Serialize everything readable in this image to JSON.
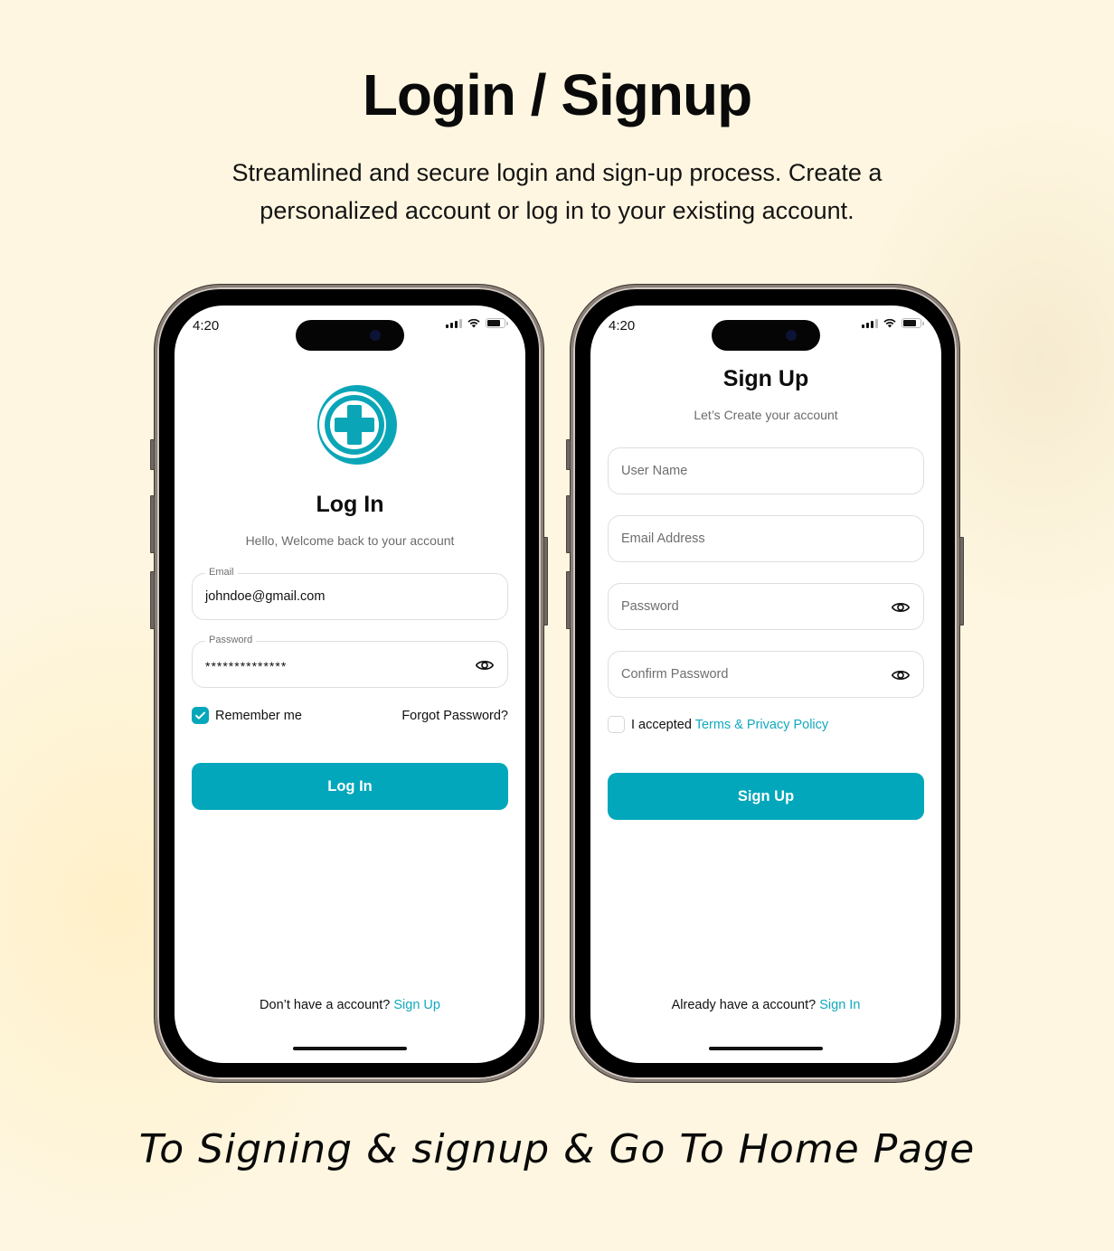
{
  "header": {
    "title": "Login / Signup",
    "subtitle": "Streamlined and secure login and sign-up process. Create a personalized account or log in to your existing account."
  },
  "caption": "To Signing & signup & Go To Home Page",
  "colors": {
    "accent": "#02a7bb",
    "background": "#fef6e0",
    "text": "#0b0b0b"
  },
  "status_bar": {
    "time": "4:20",
    "icons": [
      "signal-icon",
      "wifi-icon",
      "battery-icon"
    ]
  },
  "login": {
    "logo": "medical-cross-logo",
    "title": "Log In",
    "subtitle": "Hello, Welcome back to your account",
    "email": {
      "label": "Email",
      "value": "johndoe@gmail.com"
    },
    "password": {
      "label": "Password",
      "value": "**************",
      "icon": "eye-icon"
    },
    "remember_me": {
      "label": "Remember me",
      "checked": true
    },
    "forgot_password": "Forgot Password?",
    "submit": "Log In",
    "footer": {
      "text": "Don’t have a account?",
      "link": "Sign Up"
    }
  },
  "signup": {
    "title": "Sign Up",
    "subtitle": "Let’s Create your account",
    "fields": [
      {
        "placeholder": "User Name",
        "has_eye": false
      },
      {
        "placeholder": "Email Address",
        "has_eye": false
      },
      {
        "placeholder": "Password",
        "has_eye": true
      },
      {
        "placeholder": "Confirm Password",
        "has_eye": true
      }
    ],
    "terms": {
      "prefix": "I accepted",
      "link": "Terms & Privacy Policy",
      "checked": false
    },
    "submit": "Sign Up",
    "footer": {
      "text": "Already have a account?",
      "link": "Sign In"
    }
  }
}
